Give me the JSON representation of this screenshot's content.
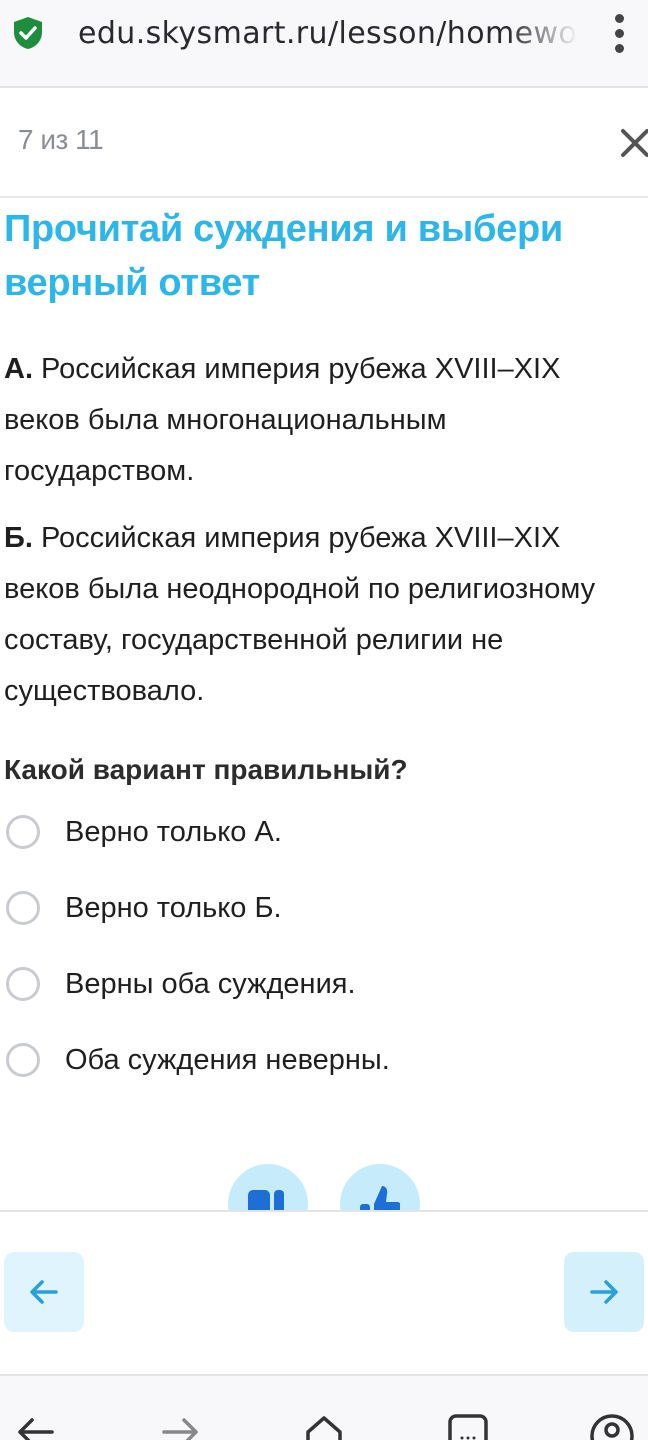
{
  "browser": {
    "url": "edu.skysmart.ru/lesson/homework",
    "icons": {
      "security": "shield-check-icon",
      "menu": "kebab-menu-icon"
    },
    "bottom_nav_icons": [
      "back-arrow-icon",
      "forward-arrow-icon",
      "home-icon",
      "tabs-icon",
      "account-icon"
    ]
  },
  "header": {
    "progress": "7 из 11",
    "close_icon": "close-icon"
  },
  "task": {
    "title": "Прочитай суждения и выбери верный ответ",
    "statements": [
      {
        "prefix": "А.",
        "text": " Российская империя рубежа XVIII–XIX веков была многонациональным государством."
      },
      {
        "prefix": "Б.",
        "text": " Российская империя рубежа XVIII–XIX веков была неоднородной по религиозному составу, государственной религии не существовало."
      }
    ],
    "question": "Какой вариант правильный?",
    "options": [
      "Верно только А.",
      "Верно только Б.",
      "Верны оба суждения.",
      "Оба суждения неверны."
    ]
  },
  "feedback": {
    "icons": [
      "dislike-icon",
      "like-icon"
    ]
  },
  "navigation": {
    "prev_icon": "arrow-left-icon",
    "next_icon": "arrow-right-icon"
  },
  "colors": {
    "accent": "#2cb6ea",
    "nav_button_bg": "#dff4fc",
    "shield_green": "#1e8e3e"
  }
}
